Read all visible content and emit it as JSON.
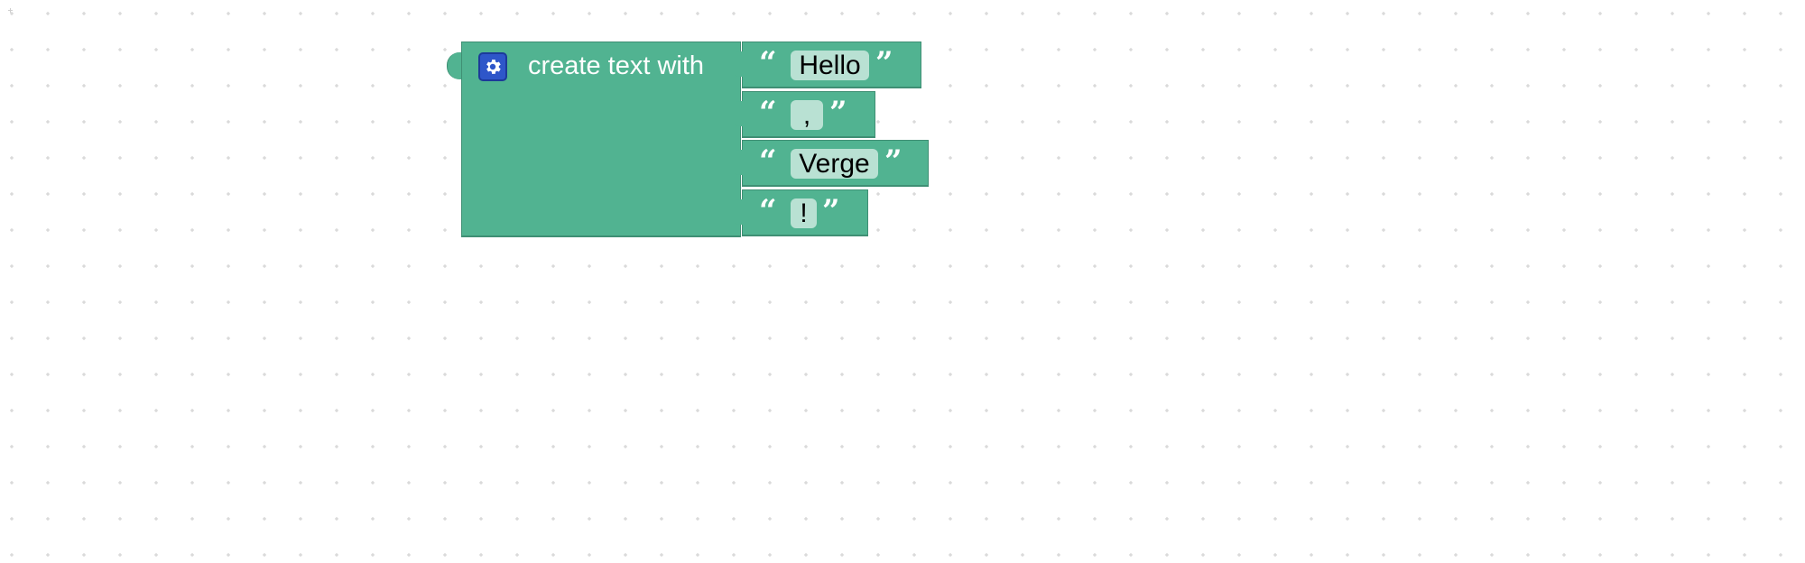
{
  "workspace": {
    "background": "#ffffff",
    "block_color": "#51b391",
    "mutator_color": "#2e56c9"
  },
  "main_block": {
    "label": "create text with",
    "mutator_icon": "gear-icon"
  },
  "text_items": [
    {
      "open_quote": "“",
      "value": "Hello",
      "close_quote": "”"
    },
    {
      "open_quote": "“",
      "value": ",",
      "close_quote": "”"
    },
    {
      "open_quote": "“",
      "value": "Verge",
      "close_quote": "”"
    },
    {
      "open_quote": "“",
      "value": "!",
      "close_quote": "”"
    }
  ]
}
